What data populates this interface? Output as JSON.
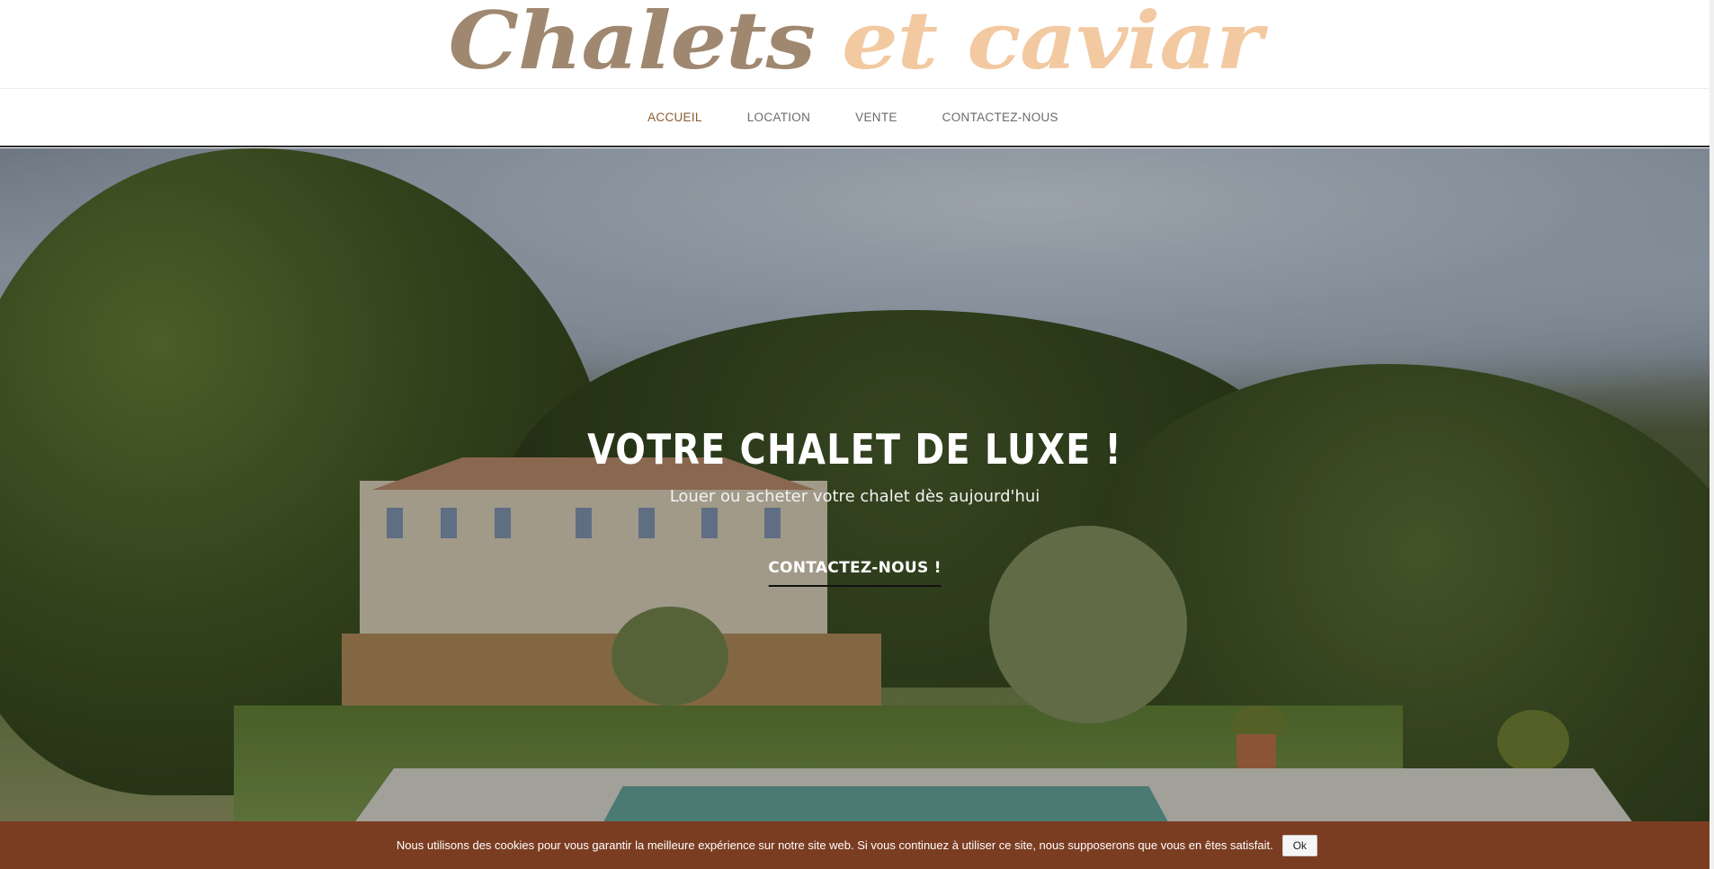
{
  "header": {
    "logo_part1": "Chalets",
    "logo_part2": "et caviar",
    "logo_color_1": "#a08870",
    "logo_color_2": "#f2c9a1"
  },
  "nav": {
    "items": [
      {
        "label": "ACCUEIL",
        "active": true
      },
      {
        "label": "LOCATION",
        "active": false
      },
      {
        "label": "VENTE",
        "active": false
      },
      {
        "label": "CONTACTEZ-NOUS",
        "active": false
      }
    ],
    "active_color": "#8b5a2b"
  },
  "hero": {
    "title": "VOTRE CHALET DE LUXE !",
    "subtitle": "Louer ou acheter votre chalet dès aujourd'hui",
    "cta_label": "CONTACTEZ-NOUS !"
  },
  "cookie": {
    "message": "Nous utilisons des cookies pour vous garantir la meilleure expérience sur notre site web. Si vous continuez à utiliser ce site, nous supposerons que vous en êtes satisfait.",
    "ok_label": "Ok",
    "bar_color": "#7b3d22"
  }
}
